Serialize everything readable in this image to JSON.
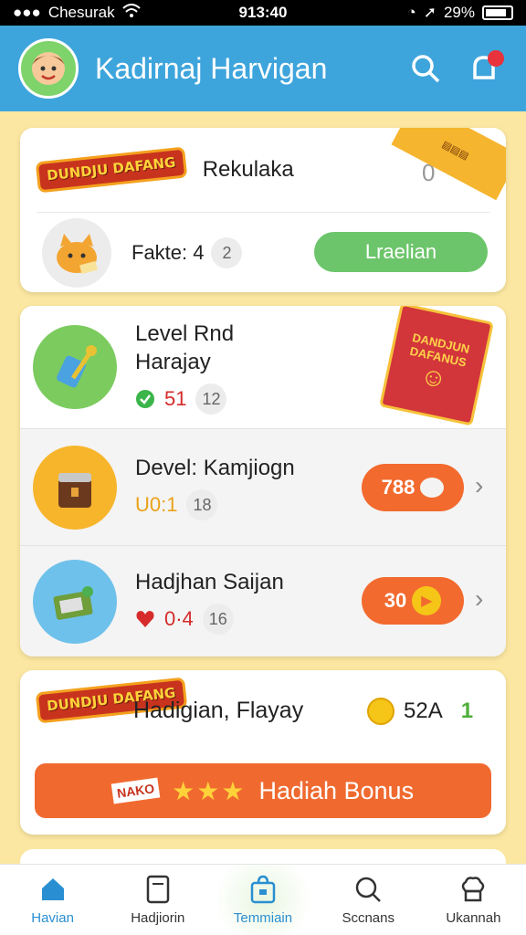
{
  "status_bar": {
    "carrier": "Chesurak",
    "time": "913:40",
    "battery": "29%"
  },
  "header": {
    "title": "Kadirnaj Harvigan"
  },
  "card1": {
    "logo_text": "DUNDJU DAFANG",
    "title": "Rekulaka",
    "value": "0",
    "stat_label": "Fakte: 4",
    "stat_chip": "2",
    "button_label": "Lraelian"
  },
  "list": [
    {
      "title_line1": "Level Rnd",
      "title_line2": "Harajay",
      "meta_value": "51",
      "meta_chip": "12",
      "pack_text": "DANDJUN DAFANUS"
    },
    {
      "title": "Devel: Kamjiogn",
      "meta_value": "U0:1",
      "meta_chip": "18",
      "button_value": "788"
    },
    {
      "title": "Hadjhan Saijan",
      "meta_value": "0·4",
      "meta_chip": "16",
      "button_value": "30"
    }
  ],
  "card3": {
    "logo_text": "DUNDJU DAFANG",
    "title": "Hadigian, Flayay",
    "coin_value": "52A",
    "extra_value": "1",
    "bonus_tag": "NAKO",
    "bonus_label": "Hadiah Bonus"
  },
  "nav": [
    {
      "label": "Havian",
      "icon": "home-icon"
    },
    {
      "label": "Hadjiorin",
      "icon": "document-icon"
    },
    {
      "label": "Temmiain",
      "icon": "bag-icon"
    },
    {
      "label": "Sccnans",
      "icon": "search-icon"
    },
    {
      "label": "Ukannah",
      "icon": "chef-hat-icon"
    }
  ],
  "colors": {
    "header": "#3ea5dc",
    "background": "#fbe7a1",
    "accent_orange": "#f06a30",
    "accent_green": "#6cc56a"
  }
}
